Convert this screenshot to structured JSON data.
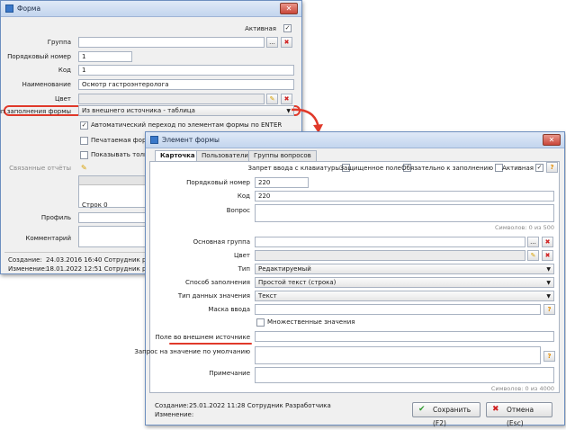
{
  "main_window": {
    "title": "Форма",
    "active_label": "Активная",
    "group_label": "Группа",
    "order_label": "Порядковый номер",
    "order_value": "1",
    "code_label": "Код",
    "code_value": "1",
    "name_label": "Наименование",
    "name_value": "Осмотр гастроэнтеролога",
    "color_label": "Цвет",
    "fill_type_label": "Тип заполнения формы",
    "fill_type_value": "Из внешнего источника - таблица",
    "auto_nav_label": "Автоматический переход по элементам формы по ENTER",
    "printed_label": "Печатаемая форма",
    "show_only_label": "Показывать только",
    "linked_reports_label": "Связанные отчёты",
    "rows_label": "Строк 0",
    "profile_label": "Профиль",
    "comment_label": "Комментарий",
    "created_label": "Создание:",
    "created_value": "24.03.2016 16:40  Сотрудник разраб",
    "changed_label": "Изменение:",
    "changed_value": "18.01.2022 12:51  Сотрудник разраб"
  },
  "element_window": {
    "title": "Элемент формы",
    "tabs": [
      "Карточка",
      "Пользователи",
      "Группы вопросов"
    ],
    "keyboard_label": "Запрет ввода с клавиатуры",
    "protected_label": "Защищенное поле",
    "required_label": "Обязательно к заполнению",
    "active_label": "Активная",
    "order_label": "Порядковый номер",
    "order_value": "220",
    "code_label": "Код",
    "code_value": "220",
    "question_label": "Вопрос",
    "question_counter": "Символов: 0 из 500",
    "main_group_label": "Основная группа",
    "color_label": "Цвет",
    "type_label": "Тип",
    "type_value": "Редактируемый",
    "fill_method_label": "Способ заполнения",
    "fill_method_value": "Простой текст (строка)",
    "data_type_label": "Тип данных значения",
    "data_type_value": "Текст",
    "mask_label": "Маска ввода",
    "multiple_label": "Множественные значения",
    "external_field_label": "Поле во внешнем источнике",
    "default_query_label": "Запрос на значение по умолчанию",
    "note_label": "Примечание",
    "note_counter": "Символов: 0 из 4000",
    "created_label": "Создание:",
    "created_value": "25.01.2022 11:28  Сотрудник Разработчика",
    "changed_label": "Изменение:",
    "save_button": "Сохранить (F2)",
    "cancel_button": "Отмена (Esc)"
  },
  "icons": {
    "ellipsis": "...",
    "clear": "✖",
    "question": "?",
    "check": "✓",
    "pencil": "✎",
    "dropdown": "▼",
    "close": "✕",
    "save": "✔"
  },
  "colors": {
    "highlight": "#e0392a",
    "titlebar": "#c3d5ee",
    "window_bg": "#f0f0f0"
  }
}
